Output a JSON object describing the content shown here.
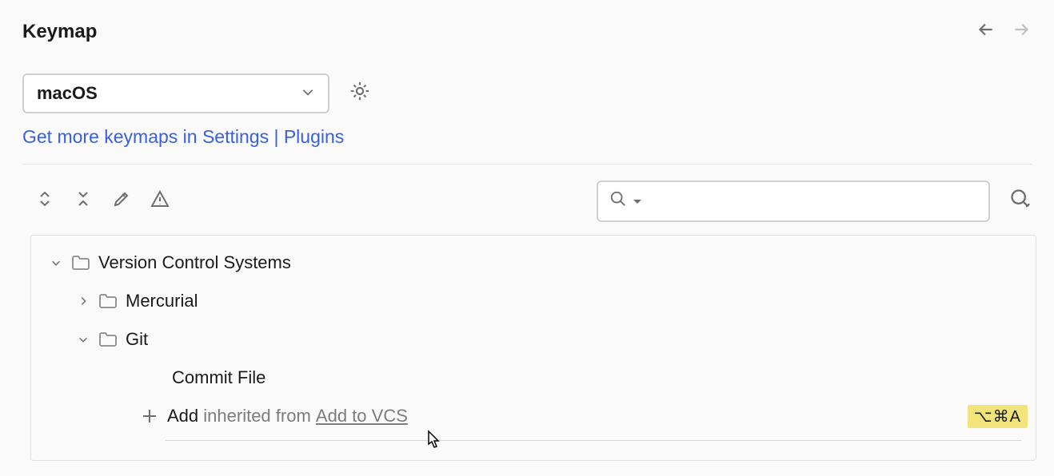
{
  "header": {
    "title": "Keymap"
  },
  "keymap": {
    "selected": "macOS",
    "more_link": "Get more keymaps in Settings | Plugins"
  },
  "tree": {
    "root": "Version Control Systems",
    "mercurial": "Mercurial",
    "git": "Git",
    "commit_file": "Commit File",
    "add": "Add",
    "inherited_prefix": "inherited from",
    "inherited_link": "Add to VCS",
    "shortcut": "⌥⌘A"
  }
}
